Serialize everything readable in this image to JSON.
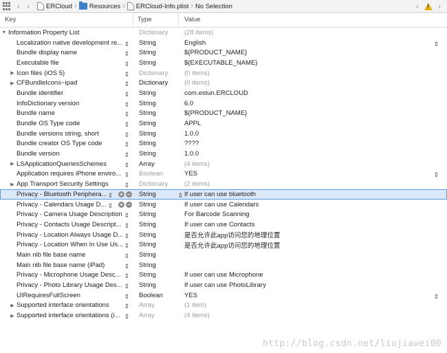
{
  "jumpbar": {
    "breadcrumbs": [
      "ERCloud",
      "Resources",
      "ERCloud-Info.plist",
      "No Selection"
    ]
  },
  "columns": {
    "key": "Key",
    "type": "Type",
    "value": "Value"
  },
  "rows": [
    {
      "key": "Information Property List",
      "type": "Dictionary",
      "value": "(28 items)",
      "level": 0,
      "disclosure": "open",
      "dim": true,
      "stepper": false
    },
    {
      "key": "Localization native development re...",
      "type": "String",
      "value": "English",
      "level": 1,
      "disclosure": "none",
      "dim": false,
      "stepper": true,
      "valueStepper": true
    },
    {
      "key": "Bundle display name",
      "type": "String",
      "value": "${PRODUCT_NAME}",
      "level": 1,
      "disclosure": "none",
      "dim": false,
      "stepper": true
    },
    {
      "key": "Executable file",
      "type": "String",
      "value": "${EXECUTABLE_NAME}",
      "level": 1,
      "disclosure": "none",
      "dim": false,
      "stepper": true
    },
    {
      "key": "Icon files (iOS 5)",
      "type": "Dictionary",
      "value": "(0 items)",
      "level": 1,
      "disclosure": "closed",
      "dim": true,
      "stepper": true
    },
    {
      "key": "CFBundleIcons~ipad",
      "type": "Dictionary",
      "value": "(0 items)",
      "level": 1,
      "disclosure": "closed",
      "dim": true,
      "typeDark": true,
      "stepper": true
    },
    {
      "key": "Bundle identifier",
      "type": "String",
      "value": "com.estun.ERCLOUD",
      "level": 1,
      "disclosure": "none",
      "dim": false,
      "stepper": true
    },
    {
      "key": "InfoDictionary version",
      "type": "String",
      "value": "6.0",
      "level": 1,
      "disclosure": "none",
      "dim": false,
      "stepper": true
    },
    {
      "key": "Bundle name",
      "type": "String",
      "value": "${PRODUCT_NAME}",
      "level": 1,
      "disclosure": "none",
      "dim": false,
      "stepper": true
    },
    {
      "key": "Bundle OS Type code",
      "type": "String",
      "value": "APPL",
      "level": 1,
      "disclosure": "none",
      "dim": false,
      "stepper": true
    },
    {
      "key": "Bundle versions string, short",
      "type": "String",
      "value": "1.0.0",
      "level": 1,
      "disclosure": "none",
      "dim": false,
      "stepper": true
    },
    {
      "key": "Bundle creator OS Type code",
      "type": "String",
      "value": "????",
      "level": 1,
      "disclosure": "none",
      "dim": false,
      "stepper": true
    },
    {
      "key": "Bundle version",
      "type": "String",
      "value": "1.0.0",
      "level": 1,
      "disclosure": "none",
      "dim": false,
      "stepper": true
    },
    {
      "key": "LSApplicationQueriesSchemes",
      "type": "Array",
      "value": "(4 items)",
      "level": 1,
      "disclosure": "closed",
      "dim": true,
      "typeDark": true,
      "stepper": true
    },
    {
      "key": "Application requires iPhone enviro...",
      "type": "Boolean",
      "value": "YES",
      "level": 1,
      "disclosure": "none",
      "dim": false,
      "typeDim": true,
      "stepper": true,
      "valueStepper": true
    },
    {
      "key": "App Transport Security Settings",
      "type": "Dictionary",
      "value": "(2 items)",
      "level": 1,
      "disclosure": "closed",
      "dim": true,
      "stepper": true
    },
    {
      "key": "Privacy - Bluetooth Periphera...",
      "type": "String",
      "value": "If user can use bluetooth",
      "level": 1,
      "disclosure": "none",
      "dim": false,
      "stepper": true,
      "selected": true,
      "plusminus": true,
      "typeStepper": true
    },
    {
      "key": "Privacy - Calendars Usage D...",
      "type": "String",
      "value": "If user can use Calendars",
      "level": 1,
      "disclosure": "none",
      "dim": false,
      "stepper": true,
      "plusminus": true
    },
    {
      "key": "Privacy - Camera Usage Description",
      "type": "String",
      "value": "For Barcode Scanning",
      "level": 1,
      "disclosure": "none",
      "dim": false,
      "stepper": true
    },
    {
      "key": "Privacy - Contacts Usage Descript...",
      "type": "String",
      "value": "If user can use Contacts",
      "level": 1,
      "disclosure": "none",
      "dim": false,
      "stepper": true
    },
    {
      "key": "Privacy - Location Always Usage D...",
      "type": "String",
      "value": "是否允许此app访问您的地理位置",
      "level": 1,
      "disclosure": "none",
      "dim": false,
      "stepper": true
    },
    {
      "key": "Privacy - Location When In Use Us...",
      "type": "String",
      "value": "是否允许此app访问您的地理位置",
      "level": 1,
      "disclosure": "none",
      "dim": false,
      "stepper": true
    },
    {
      "key": "Main nib file base name",
      "type": "String",
      "value": "",
      "level": 1,
      "disclosure": "none",
      "dim": false,
      "stepper": true
    },
    {
      "key": "Main nib file base name (iPad)",
      "type": "String",
      "value": "",
      "level": 1,
      "disclosure": "none",
      "dim": false,
      "stepper": true
    },
    {
      "key": "Privacy - Microphone Usage Desc...",
      "type": "String",
      "value": "If user can use Microphone",
      "level": 1,
      "disclosure": "none",
      "dim": false,
      "stepper": true
    },
    {
      "key": "Privacy - Photo Library Usage Des...",
      "type": "String",
      "value": "If user can use PhotoLibrary",
      "level": 1,
      "disclosure": "none",
      "dim": false,
      "stepper": true
    },
    {
      "key": "UIRequiresFullScreen",
      "type": "Boolean",
      "value": "YES",
      "level": 1,
      "disclosure": "none",
      "dim": false,
      "typeDark": true,
      "stepper": true,
      "valueStepper": true
    },
    {
      "key": "Supported interface orientations",
      "type": "Array",
      "value": "(1 item)",
      "level": 1,
      "disclosure": "closed",
      "dim": true,
      "stepper": true
    },
    {
      "key": "Supported interface orientations (i...",
      "type": "Array",
      "value": "(4 items)",
      "level": 1,
      "disclosure": "closed",
      "dim": true,
      "stepper": true
    }
  ],
  "watermark": "http://blog.csdn.net/liujiawei00"
}
